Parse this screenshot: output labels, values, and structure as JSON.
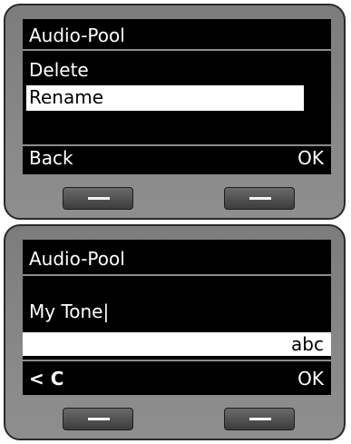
{
  "screen_top": {
    "title": "Audio-Pool",
    "menu_items": [
      "Delete",
      "Rename"
    ],
    "selected_index": 1,
    "softkey_left": "Back",
    "softkey_right": "OK"
  },
  "screen_bottom": {
    "title": "Audio-Pool",
    "input_value": "My Tone",
    "cursor": "|",
    "input_mode": "abc",
    "softkey_left": "< C",
    "softkey_right": "OK"
  },
  "icons": {
    "softkey_bar": "minus-bar-icon"
  }
}
